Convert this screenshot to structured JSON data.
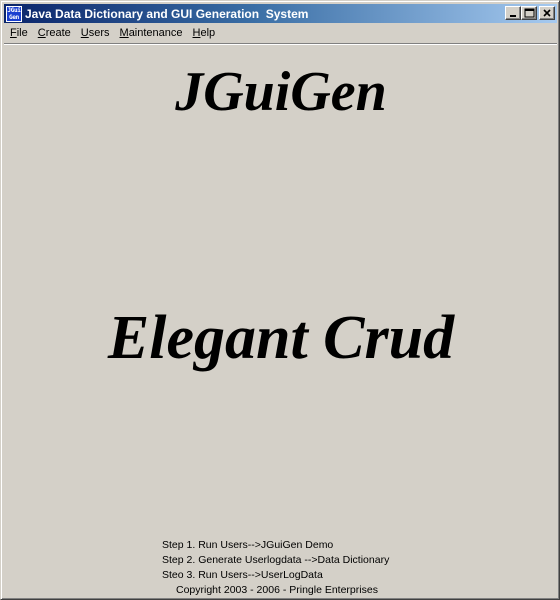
{
  "window": {
    "title": "Java Data Dictionary and GUI Generation  System",
    "icon_lines": [
      "JGui",
      "Gen"
    ],
    "icon_color": "#1a3fd0",
    "title_gradient": [
      "#0a246a",
      "#a6caf0"
    ]
  },
  "menubar": {
    "items": [
      {
        "label_u": "F",
        "label_rest": "ile"
      },
      {
        "label_u": "C",
        "label_rest": "reate"
      },
      {
        "label_u": "U",
        "label_rest": "sers"
      },
      {
        "label_u": "M",
        "label_rest": "aintenance"
      },
      {
        "label_u": "H",
        "label_rest": "elp"
      }
    ]
  },
  "main": {
    "title": "JGuiGen",
    "subtitle": "Elegant Crud",
    "steps": [
      "Step 1. Run Users-->JGuiGen Demo",
      "Step 2. Generate Userlogdata -->Data Dictionary",
      "Steo 3. Run Users-->UserLogData"
    ],
    "copyright": "Copyright 2003 - 2006 - Pringle Enterprises"
  }
}
